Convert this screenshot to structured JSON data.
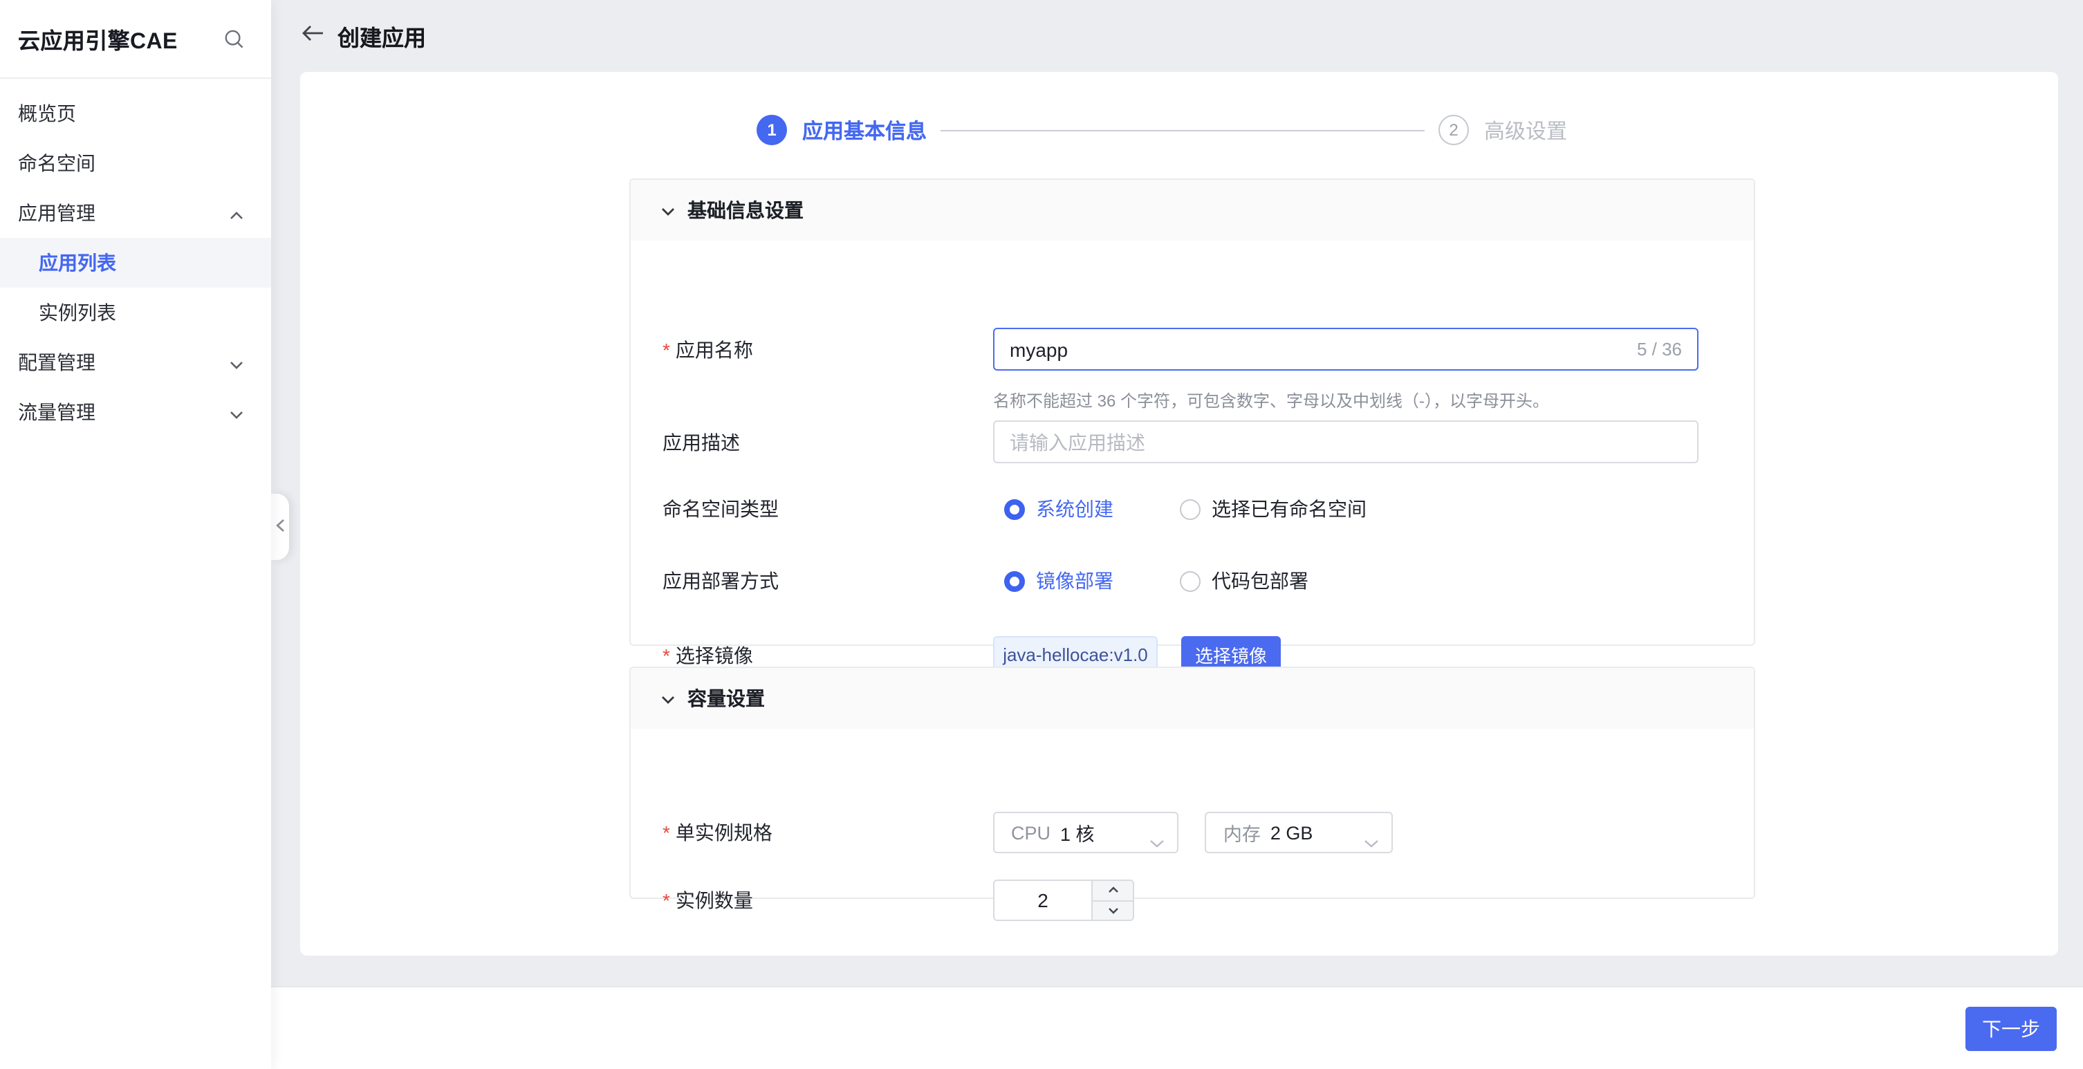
{
  "sidebar": {
    "title": "云应用引擎CAE",
    "items": [
      {
        "label": "概览页"
      },
      {
        "label": "命名空间"
      },
      {
        "label": "应用管理"
      },
      {
        "label": "应用列表"
      },
      {
        "label": "实例列表"
      },
      {
        "label": "配置管理"
      },
      {
        "label": "流量管理"
      }
    ]
  },
  "header": {
    "title": "创建应用"
  },
  "steps": {
    "step1": {
      "num": "1",
      "label": "应用基本信息"
    },
    "step2": {
      "num": "2",
      "label": "高级设置"
    }
  },
  "form": {
    "basic": {
      "title": "基础信息设置",
      "name_label": "应用名称",
      "name_value": "myapp",
      "name_counter": "5 / 36",
      "name_help": "名称不能超过 36 个字符，可包含数字、字母以及中划线（-），以字母开头。",
      "desc_label": "应用描述",
      "desc_placeholder": "请输入应用描述",
      "ns_label": "命名空间类型",
      "ns_option1": "系统创建",
      "ns_option2": "选择已有命名空间",
      "deploy_label": "应用部署方式",
      "deploy_option1": "镜像部署",
      "deploy_option2": "代码包部署",
      "image_label": "选择镜像",
      "image_tag": "java-hellocae:v1.0",
      "image_button": "选择镜像"
    },
    "capacity": {
      "title": "容量设置",
      "spec_label": "单实例规格",
      "cpu_prefix": "CPU",
      "cpu_value": "1 核",
      "mem_prefix": "内存",
      "mem_value": "2 GB",
      "count_label": "实例数量",
      "count_value": "2"
    }
  },
  "footer": {
    "next": "下一步"
  },
  "colors": {
    "primary": "#4a6af0",
    "background": "#ecedf1",
    "radio_on": "#3e62f0"
  }
}
